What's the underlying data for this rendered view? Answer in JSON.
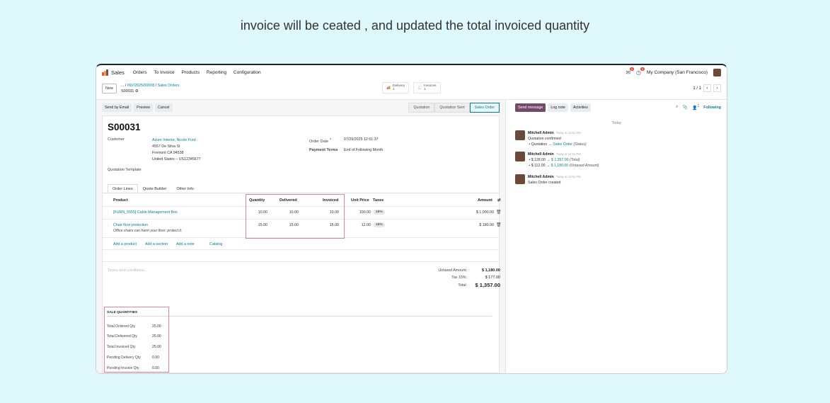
{
  "caption": "invoice will be ceated , and updated the total invoiced quantity",
  "nav": {
    "app": "Sales",
    "menu": [
      "Orders",
      "To Invoice",
      "Products",
      "Reporting",
      "Configuration"
    ],
    "company": "My Company (San Francisco)",
    "msg_count": "9",
    "activity_count": "3"
  },
  "breadcrumb": {
    "new_label": "New",
    "dots": "...",
    "path1": "INV/2025/00008",
    "path2": "Sales Orders",
    "record": "S00031",
    "gear": "⚙"
  },
  "smart_buttons": [
    {
      "icon": "🚚",
      "label": "Delivery",
      "count": "1"
    },
    {
      "icon": "🧾",
      "label": "Invoices",
      "count": "1"
    }
  ],
  "pager": {
    "text": "1 / 1",
    "prev": "‹",
    "next": "›"
  },
  "actions": [
    "Send by Email",
    "Preview",
    "Cancel"
  ],
  "stages": [
    "Quotation",
    "Quotation Sent",
    "Sales Order"
  ],
  "form": {
    "name": "S00031",
    "customer_label": "Customer",
    "customer_name": "Azure Interior, Nicole Ford",
    "address": [
      "4557 De Silva St",
      "Fremont CA 94538",
      "United States – US12345677"
    ],
    "order_date_label": "Order Date",
    "order_date_help": "?",
    "order_date": "07/29/2025 12:51:37",
    "payment_terms_label": "Payment Terms",
    "payment_terms": "End of Following Month",
    "template_label": "Quotation Template"
  },
  "tabs": [
    "Order Lines",
    "Quote Builder",
    "Other Info"
  ],
  "columns": {
    "product": "Product",
    "quantity": "Quantity",
    "delivered": "Delivered",
    "invoiced": "Invoiced",
    "unit_price": "Unit Price",
    "taxes": "Taxes",
    "amount": "Amount",
    "optional_icon": "⇄"
  },
  "lines": [
    {
      "product": "[FURN_5555] Cable Management Box",
      "note": "",
      "quantity": "10.00",
      "delivered": "10.00",
      "invoiced": "10.00",
      "unit_price": "100.00",
      "tax": "15%",
      "amount": "$ 1,000.00"
    },
    {
      "product": "Chair floor protection",
      "note": "Office chairs can harm your floor: protect it.",
      "quantity": "15.00",
      "delivered": "15.00",
      "invoiced": "15.00",
      "unit_price": "12.00",
      "tax": "15%",
      "amount": "$ 180.00"
    }
  ],
  "add_links": [
    "Add a product",
    "Add a section",
    "Add a note",
    "Catalog"
  ],
  "terms_placeholder": "Terms and conditions...",
  "totals": {
    "untaxed_label": "Untaxed Amount:",
    "untaxed": "$ 1,180.00",
    "tax_label": "Tax 15%:",
    "tax": "$ 177.00",
    "total_label": "Total:",
    "total": "$ 1,357.00"
  },
  "sale_quantities": {
    "title": "SALE QUANTITIES",
    "rows": [
      {
        "label": "Total Ordered Qty",
        "value": "25.00"
      },
      {
        "label": "Total Delivered Qty",
        "value": "25.00"
      },
      {
        "label": "Total Invoiced Qty",
        "value": "25.00"
      },
      {
        "label": "Pending Delivery Qty",
        "value": "0.00"
      },
      {
        "label": "Pending Invoice Qty",
        "value": "0.00"
      }
    ]
  },
  "chatter": {
    "send_message": "Send message",
    "log_note": "Log note",
    "activities": "Activities",
    "followers_count": "1",
    "following": "Following",
    "today": "Today",
    "messages": [
      {
        "author": "Mitchell Admin",
        "time": "Today at 12:51 PM",
        "text": "Quotation confirmed",
        "changes": [
          {
            "from": "Quotation",
            "to": "Sales Order",
            "field": "(Status)"
          }
        ]
      },
      {
        "author": "Mitchell Admin",
        "time": "Today at 12:51 PM",
        "text": "",
        "changes": [
          {
            "from": "$ 128.00",
            "to": "$ 1,357.00",
            "field": "(Total)"
          },
          {
            "from": "$ 112.00",
            "to": "$ 1,180.00",
            "field": "(Untaxed Amount)"
          }
        ]
      },
      {
        "author": "Mitchell Admin",
        "time": "Today at 12:51 PM",
        "text": "Sales Order created",
        "changes": []
      }
    ]
  },
  "colors": {
    "accent": "#0a7e8c",
    "brand": "#714b67",
    "highlight_box": "#e88585"
  }
}
